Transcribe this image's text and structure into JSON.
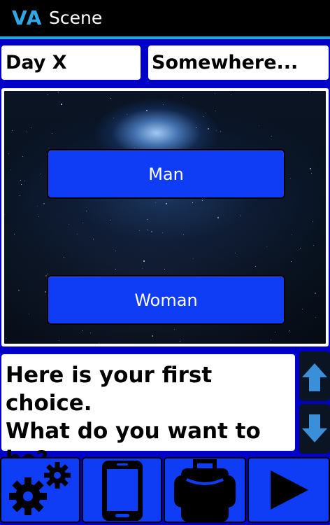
{
  "app": {
    "logo": "VA",
    "title": "Scene"
  },
  "status": {
    "day": "Day X",
    "location": "Somewhere..."
  },
  "scene": {
    "choices": [
      {
        "label": "Man"
      },
      {
        "label": "Woman"
      }
    ]
  },
  "dialog": {
    "line1": "Here is your first choice.",
    "line2": "What do you want to be?"
  },
  "scroll": {
    "up_icon": "arrow-up-icon",
    "down_icon": "arrow-down-icon"
  },
  "toolbar": {
    "items": [
      {
        "icon": "gears-icon"
      },
      {
        "icon": "phone-icon"
      },
      {
        "icon": "backpack-icon"
      },
      {
        "icon": "play-icon"
      }
    ]
  },
  "colors": {
    "background": "#0000c8",
    "button": "#0f3cf5",
    "accent": "#2fa8e6",
    "scroll_arrow": "#3a8fd8"
  }
}
